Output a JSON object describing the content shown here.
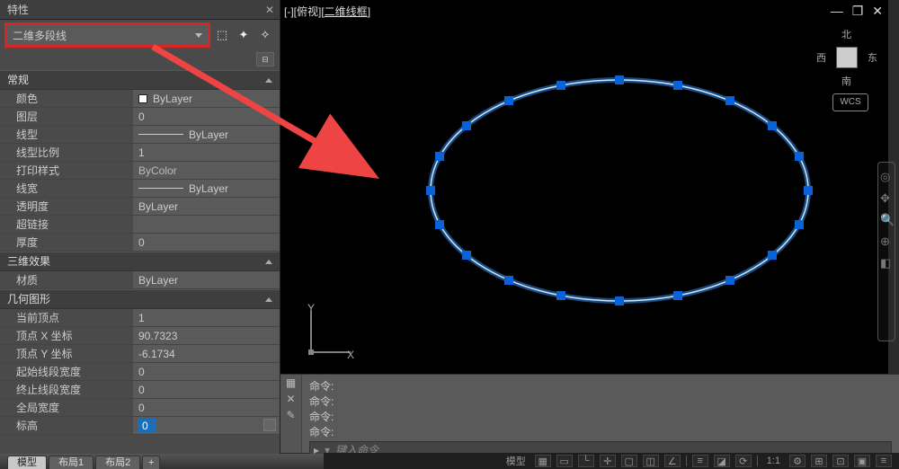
{
  "panel": {
    "title": "特性",
    "selector": "二维多段线",
    "sections": {
      "general": {
        "header": "常规",
        "rows": {
          "color": {
            "label": "颜色",
            "value": "ByLayer"
          },
          "layer": {
            "label": "图层",
            "value": "0"
          },
          "linetype": {
            "label": "线型",
            "value": "ByLayer"
          },
          "ltscale": {
            "label": "线型比例",
            "value": "1"
          },
          "plotstyle": {
            "label": "打印样式",
            "value": "ByColor"
          },
          "lineweight": {
            "label": "线宽",
            "value": "ByLayer"
          },
          "transparency": {
            "label": "透明度",
            "value": "ByLayer"
          },
          "hyperlink": {
            "label": "超链接",
            "value": ""
          },
          "thickness": {
            "label": "厚度",
            "value": "0"
          }
        }
      },
      "threed": {
        "header": "三维效果",
        "rows": {
          "material": {
            "label": "材质",
            "value": "ByLayer"
          }
        }
      },
      "geometry": {
        "header": "几何图形",
        "rows": {
          "curvertex": {
            "label": "当前顶点",
            "value": "1"
          },
          "vertx": {
            "label": "顶点 X 坐标",
            "value": "90.7323"
          },
          "verty": {
            "label": "顶点 Y 坐标",
            "value": "-6.1734"
          },
          "startw": {
            "label": "起始线段宽度",
            "value": "0"
          },
          "endw": {
            "label": "终止线段宽度",
            "value": "0"
          },
          "globalw": {
            "label": "全局宽度",
            "value": "0"
          },
          "elev": {
            "label": "标高",
            "value": "0"
          }
        }
      }
    }
  },
  "canvas": {
    "title_prefix": "[-][俯视][",
    "title_mid": "二维线框",
    "title_suffix": "]",
    "viewcube": {
      "n": "北",
      "s": "南",
      "e": "东",
      "w": "西"
    },
    "wcs": "WCS",
    "ucs": {
      "x": "X",
      "y": "Y"
    }
  },
  "cmd": {
    "line": "命令:",
    "placeholder": "键入命令",
    "prompt_icon": "▸"
  },
  "tabs": {
    "model": "模型",
    "layout1": "布局1",
    "layout2": "布局2",
    "add": "+"
  },
  "status": {
    "model": "模型",
    "scale": "1:1"
  },
  "icons": {
    "quick_select": "⬚",
    "quick_calc": "✦",
    "pick_add": "✧",
    "collapse": "⊟",
    "close": "✕",
    "min": "—",
    "max": "❐",
    "grip_hash": "▦",
    "pin": "✕",
    "wrench": "✎"
  }
}
